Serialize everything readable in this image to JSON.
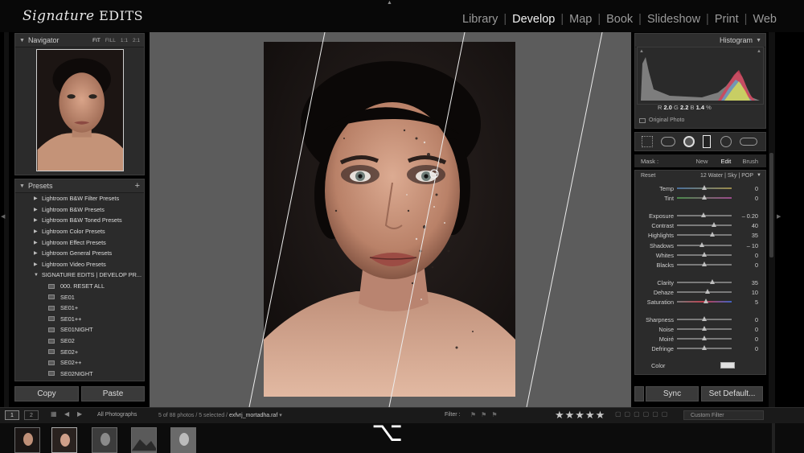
{
  "app": {
    "logo_script": "Signature",
    "logo_caps": "EDITS"
  },
  "modules": [
    "Library",
    "Develop",
    "Map",
    "Book",
    "Slideshow",
    "Print",
    "Web"
  ],
  "active_module": "Develop",
  "navigator": {
    "title": "Navigator",
    "zoom_options": [
      "FIT",
      "FILL",
      "1:1",
      "2:1"
    ],
    "active_zoom": "FIT"
  },
  "presets": {
    "title": "Presets",
    "add": "+",
    "groups": [
      "Lightroom B&W Filter Presets",
      "Lightroom B&W Presets",
      "Lightroom B&W Toned Presets",
      "Lightroom Color Presets",
      "Lightroom Effect Presets",
      "Lightroom General Presets",
      "Lightroom Video Presets",
      "SIGNATURE EDITS | DEVELOP PR..."
    ],
    "items": [
      "000. RESET ALL",
      "SE01",
      "SE01+",
      "SE01++",
      "SE01NIGHT",
      "SE02",
      "SE02+",
      "SE02++",
      "SE02NIGHT"
    ]
  },
  "left_buttons": {
    "copy": "Copy",
    "paste": "Paste"
  },
  "histogram": {
    "title": "Histogram",
    "r_label": "R",
    "r_value": "2.0",
    "g_label": "G",
    "g_value": "2.2",
    "b_label": "B",
    "b_value": "1.4",
    "percent": "%",
    "original_photo": "Original Photo"
  },
  "mask": {
    "label": "Mask :",
    "options": [
      "New",
      "Edit",
      "Brush"
    ],
    "active": "Edit"
  },
  "effect": {
    "reset": "Reset",
    "preset_name": "12 Water | Sky | POP"
  },
  "sliders": [
    {
      "label": "Temp",
      "value": "0",
      "pos": 0.5,
      "kind": "temp"
    },
    {
      "label": "Tint",
      "value": "0",
      "pos": 0.5,
      "kind": "tint"
    },
    {
      "label": "Exposure",
      "value": "– 0.20",
      "pos": 0.48
    },
    {
      "label": "Contrast",
      "value": "40",
      "pos": 0.67
    },
    {
      "label": "Highlights",
      "value": "35",
      "pos": 0.64
    },
    {
      "label": "Shadows",
      "value": "– 10",
      "pos": 0.46
    },
    {
      "label": "Whites",
      "value": "0",
      "pos": 0.5
    },
    {
      "label": "Blacks",
      "value": "0",
      "pos": 0.5
    },
    {
      "label": "Clarity",
      "value": "35",
      "pos": 0.64
    },
    {
      "label": "Dehaze",
      "value": "10",
      "pos": 0.56
    },
    {
      "label": "Saturation",
      "value": "5",
      "pos": 0.53,
      "kind": "sat"
    },
    {
      "label": "Sharpness",
      "value": "0",
      "pos": 0.5
    },
    {
      "label": "Noise",
      "value": "0",
      "pos": 0.5
    },
    {
      "label": "Moiré",
      "value": "0",
      "pos": 0.5
    },
    {
      "label": "Defringe",
      "value": "0",
      "pos": 0.5
    }
  ],
  "color_label": "Color",
  "right_buttons": {
    "sync": "Sync",
    "set_default": "Set Default..."
  },
  "filmbar": {
    "page1": "1",
    "page2": "2",
    "source": "All Photographs",
    "count": "5 of 88 photos / 5 selected /",
    "filename": "exfvrj_mortadha.raf",
    "filter_label": "Filter :",
    "stars": "★★★★★",
    "custom_filter": "Custom Filter"
  },
  "colors": {
    "accent_active": "#f2f2f2",
    "panel_bg": "#2b2b2b",
    "center_bg": "#5c5c5c"
  }
}
